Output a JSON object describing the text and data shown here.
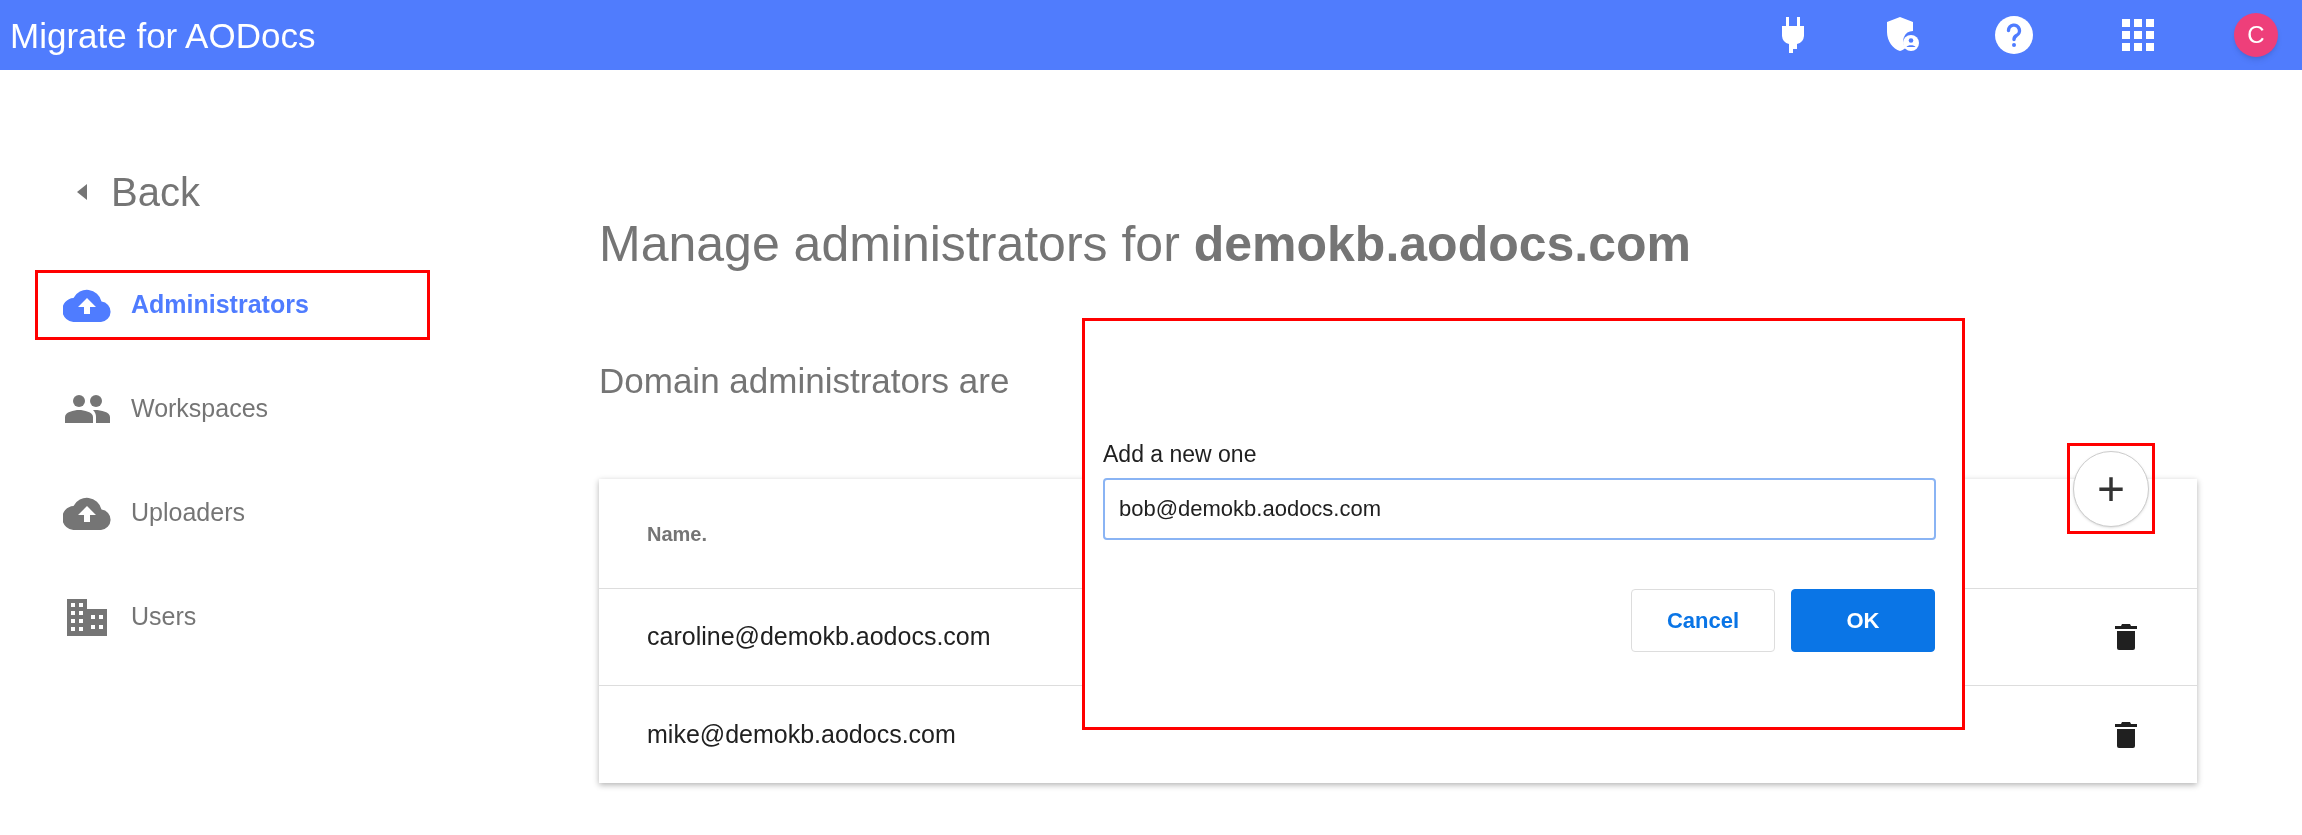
{
  "app_bar": {
    "title": "Migrate for AODocs",
    "avatar": {
      "initial": "C"
    }
  },
  "sidebar": {
    "back": {
      "label": "Back"
    },
    "items": [
      {
        "label": "Administrators",
        "kind": "cloud",
        "selected": true,
        "highlighted": true
      },
      {
        "label": "Workspaces",
        "kind": "people",
        "selected": false,
        "highlighted": false
      },
      {
        "label": "Uploaders",
        "kind": "cloud",
        "selected": false,
        "highlighted": false
      },
      {
        "label": "Users",
        "kind": "building",
        "selected": false,
        "highlighted": false
      }
    ]
  },
  "page": {
    "heading": "Manage administrators for **demokb.aodocs.com**",
    "subtitle": "Domain administrators are",
    "add_button": {
      "label": "+",
      "highlighted": true
    },
    "table": {
      "columns": [
        "Name."
      ],
      "rows": [
        {
          "name": "caroline@demokb.aodocs.com"
        },
        {
          "name": "mike@demokb.aodocs.com"
        }
      ]
    }
  },
  "dialog": {
    "highlighted": true,
    "label": "Add a new one",
    "value": "bob@demokb.aodocs.com",
    "buttons": [
      {
        "label": "Cancel",
        "kind": "secondary"
      },
      {
        "label": "OK",
        "kind": "primary"
      }
    ]
  }
}
